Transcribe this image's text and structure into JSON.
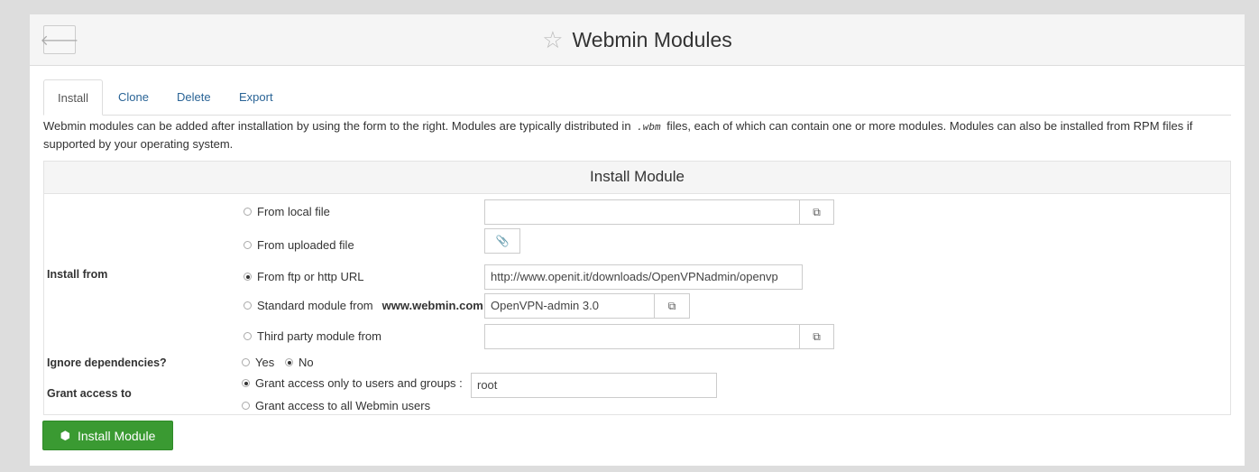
{
  "header": {
    "title": "Webmin Modules",
    "back_icon": "arrow-left-icon",
    "star_icon": "star-outline-icon"
  },
  "tabs": [
    {
      "label": "Install",
      "active": true
    },
    {
      "label": "Clone",
      "active": false
    },
    {
      "label": "Delete",
      "active": false
    },
    {
      "label": "Export",
      "active": false
    }
  ],
  "description": {
    "part1": "Webmin modules can be added after installation by using the form to the right. Modules are typically distributed in ",
    "code": ".wbm",
    "part2": " files, each of which can contain one or more modules. Modules can also be installed from RPM files if supported by your operating system."
  },
  "form": {
    "heading": "Install Module",
    "install_from_label": "Install from",
    "options": {
      "local_file": "From local file",
      "uploaded_file": "From uploaded file",
      "url": "From ftp or http URL",
      "standard": "Standard module from",
      "standard_site": "www.webmin.com",
      "third_party": "Third party module from"
    },
    "selected_option": "url",
    "local_file_value": "",
    "url_value": "http://www.openit.it/downloads/OpenVPNadmin/openvp",
    "standard_value": "OpenVPN-admin 3.0",
    "third_party_value": "",
    "ignore_deps_label": "Ignore dependencies?",
    "ignore_yes": "Yes",
    "ignore_no": "No",
    "ignore_selected": "No",
    "grant_label": "Grant access to",
    "grant_only": "Grant access only to users and groups :",
    "grant_all": "Grant access to all Webmin users",
    "grant_value": "root",
    "submit_label": "Install Module",
    "accent_color": "#3a9a32"
  }
}
